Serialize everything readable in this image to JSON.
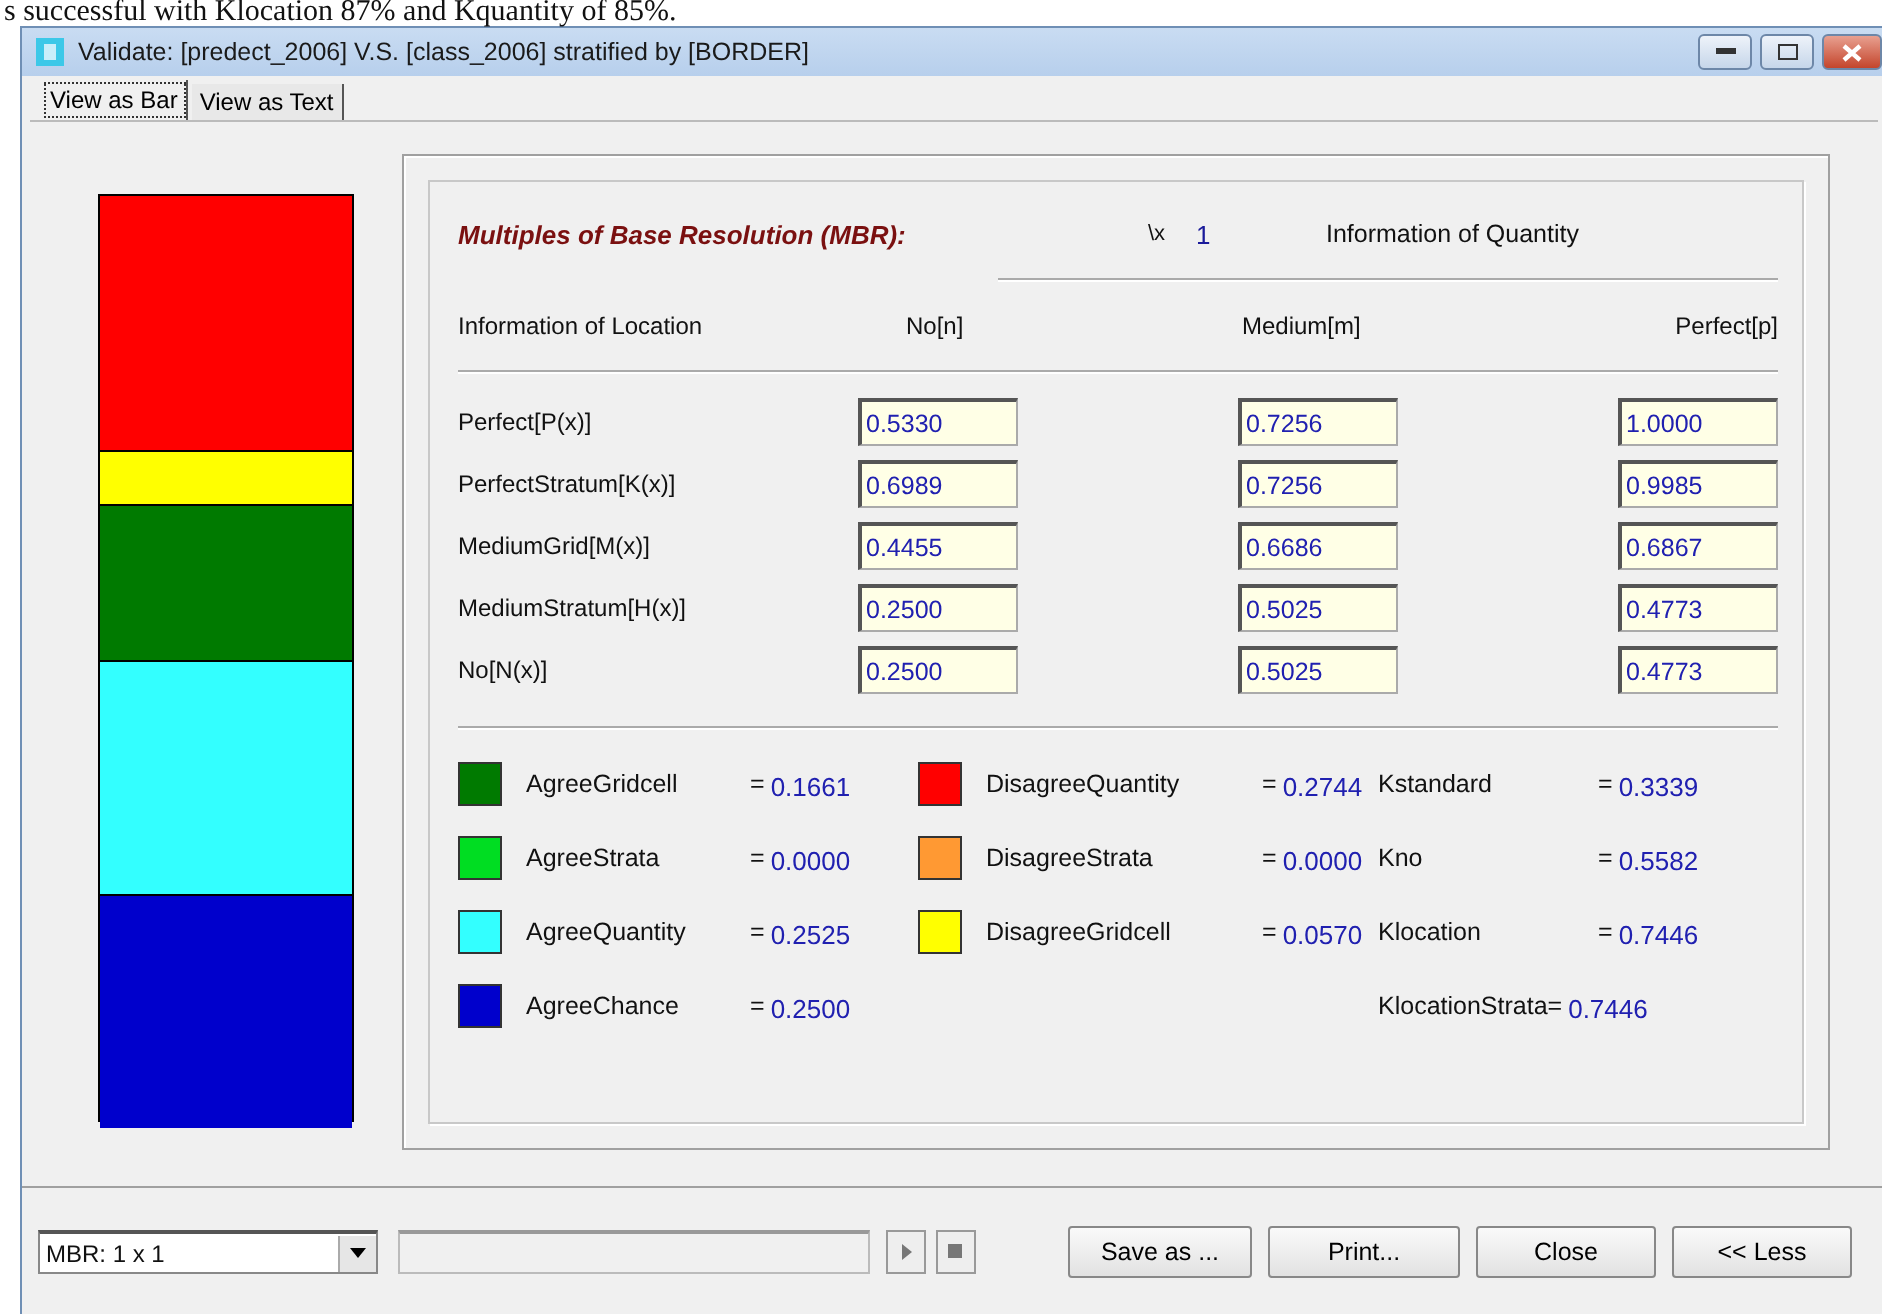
{
  "page_text": "s successful with Klocation 87% and Kquantity of 85%.",
  "window": {
    "title": "Validate: [predect_2006]  V.S.  [class_2006] stratified by [BORDER]"
  },
  "tabs": [
    {
      "label": "View as Bar",
      "selected": true
    },
    {
      "label": "View as Text",
      "selected": false
    }
  ],
  "mbr": {
    "label": "Multiples of Base Resolution (MBR):",
    "sign": "\\x",
    "value": "1"
  },
  "quantity_heading": "Information of Quantity",
  "location_heading": "Information of Location",
  "columns": [
    "No[n]",
    "Medium[m]",
    "Perfect[p]"
  ],
  "rows": [
    {
      "label": "Perfect[P(x)]",
      "values": [
        "0.5330",
        "0.7256",
        "1.0000"
      ]
    },
    {
      "label": "PerfectStratum[K(x)]",
      "values": [
        "0.6989",
        "0.7256",
        "0.9985"
      ]
    },
    {
      "label": "MediumGrid[M(x)]",
      "values": [
        "0.4455",
        "0.6686",
        "0.6867"
      ]
    },
    {
      "label": "MediumStratum[H(x)]",
      "values": [
        "0.2500",
        "0.5025",
        "0.4773"
      ]
    },
    {
      "label": "No[N(x)]",
      "values": [
        "0.2500",
        "0.5025",
        "0.4773"
      ]
    }
  ],
  "legend": [
    {
      "kind": "agree",
      "label": "AgreeGridcell",
      "equals": "=",
      "value": "0.1661",
      "color": "#007a00"
    },
    {
      "kind": "agree",
      "label": "AgreeStrata",
      "equals": "=",
      "value": "0.0000",
      "color": "#00dd22"
    },
    {
      "kind": "agree",
      "label": "AgreeQuantity",
      "equals": "=",
      "value": "0.2525",
      "color": "#33ffff"
    },
    {
      "kind": "agree",
      "label": "AgreeChance",
      "equals": "=",
      "value": "0.2500",
      "color": "#0000cc"
    },
    {
      "kind": "disagree",
      "label": "DisagreeQuantity",
      "equals": "=",
      "value": "0.2744",
      "color": "#ff0000"
    },
    {
      "kind": "disagree",
      "label": "DisagreeStrata",
      "equals": "=",
      "value": "0.0000",
      "color": "#ff9933"
    },
    {
      "kind": "disagree",
      "label": "DisagreeGridcell",
      "equals": "=",
      "value": "0.0570",
      "color": "#ffff00"
    }
  ],
  "stats": [
    {
      "label": "Kstandard",
      "equals": "=",
      "value": "0.3339"
    },
    {
      "label": "Kno",
      "equals": "=",
      "value": "0.5582"
    },
    {
      "label": "Klocation",
      "equals": "=",
      "value": "0.7446"
    },
    {
      "label": "KlocationStrata",
      "equals": "=",
      "value": "0.7446"
    }
  ],
  "dropdown": {
    "value": "MBR: 1 x 1"
  },
  "buttons": [
    "Save as ...",
    "Print...",
    "Close",
    "<< Less"
  ]
}
